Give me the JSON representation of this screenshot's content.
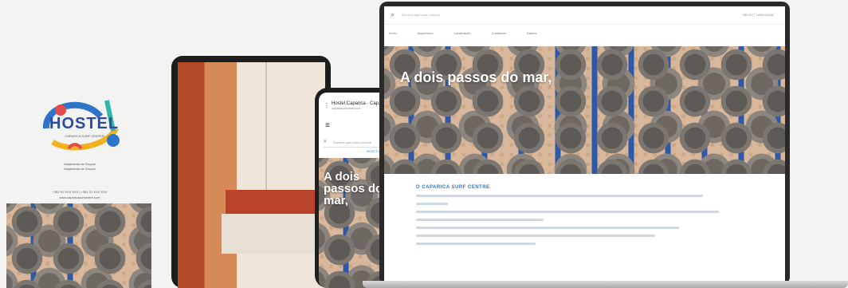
{
  "brochure": {
    "logo_text": "HOSTEL",
    "logo_sub": "CAPARICA SURF CENTER",
    "small_lines": [
      "Alojamento de Grupos",
      "Alojamento de Grupos"
    ],
    "contact": "+351 91 XXX XXX | +351 21 XXX XXX",
    "website": "www.caparicasurfcentre.com"
  },
  "phone": {
    "url": "Hostel Caparica - Cap...",
    "url_sub": "caparicasurfcentre.com",
    "search_placeholder": "Escreva aqui para procurar",
    "select_label": "SELECT LANGUAGE",
    "hero_title": "A dois passos do mar,"
  },
  "laptop": {
    "search_placeholder": "Escreva aqui para procurar",
    "top_right": "SELECT LANGUAGE",
    "nav": [
      "Início",
      "Alojamento",
      "Localização",
      "Contactos",
      "Galeria"
    ],
    "hero_title": "A dois passos do mar,",
    "section_title": "O CAPARICA SURF CENTRE"
  }
}
